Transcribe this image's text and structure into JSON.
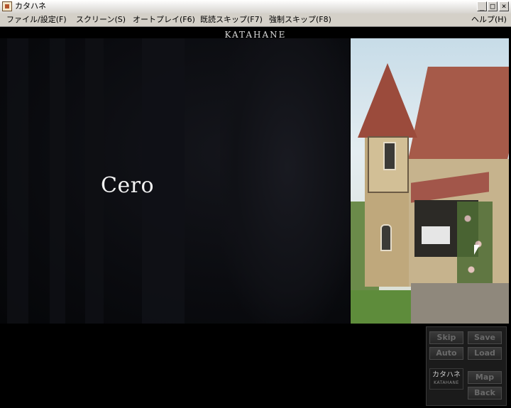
{
  "window": {
    "title": "カタハネ",
    "controls": {
      "minimize": "_",
      "maximize": "□",
      "close": "×"
    }
  },
  "menu": {
    "items": [
      "ファイル/設定(F)",
      "スクリーン(S)",
      "オートプレイ(F6)",
      "既読スキップ(F7)",
      "強制スキップ(F8)"
    ],
    "help": "ヘルプ(H)"
  },
  "logo": "KATAHANE",
  "dialogue": {
    "speaker": "Cero"
  },
  "controls": {
    "skip": "Skip",
    "save": "Save",
    "auto": "Auto",
    "load": "Load",
    "map": "Map",
    "back": "Back",
    "panel_logo": "カタハネ",
    "panel_logo_sub": "KATAHANE"
  },
  "colors": {
    "background": "#000000",
    "menubar": "#d4d0c8",
    "button_text": "#6a6a6a"
  }
}
